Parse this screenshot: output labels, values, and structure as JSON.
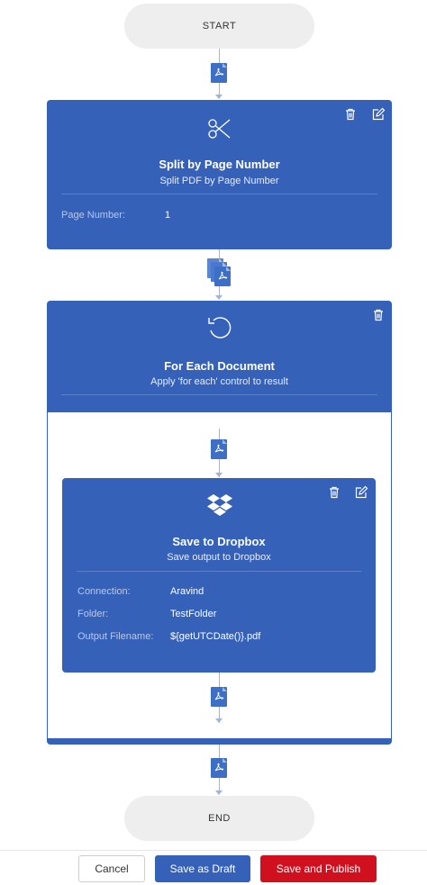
{
  "flow": {
    "start_label": "START",
    "end_label": "END"
  },
  "split_step": {
    "title": "Split by Page Number",
    "subtitle": "Split PDF by Page Number",
    "fields": [
      {
        "label": "Page Number:",
        "value": "1"
      }
    ],
    "icon": "scissors-icon"
  },
  "foreach_step": {
    "title": "For Each Document",
    "subtitle": "Apply 'for each' control to result",
    "icon": "loop-icon"
  },
  "dropbox_step": {
    "title": "Save to Dropbox",
    "subtitle": "Save output to Dropbox",
    "fields": [
      {
        "label": "Connection:",
        "value": "Aravind"
      },
      {
        "label": "Folder:",
        "value": "TestFolder"
      },
      {
        "label": "Output Filename:",
        "value": "${getUTCDate()}.pdf"
      }
    ],
    "icon": "dropbox-icon"
  },
  "footer": {
    "cancel_label": "Cancel",
    "draft_label": "Save as Draft",
    "publish_label": "Save and Publish"
  },
  "colors": {
    "card": "#3561b8",
    "connector": "#9fb5de",
    "publish": "#d0101e"
  }
}
